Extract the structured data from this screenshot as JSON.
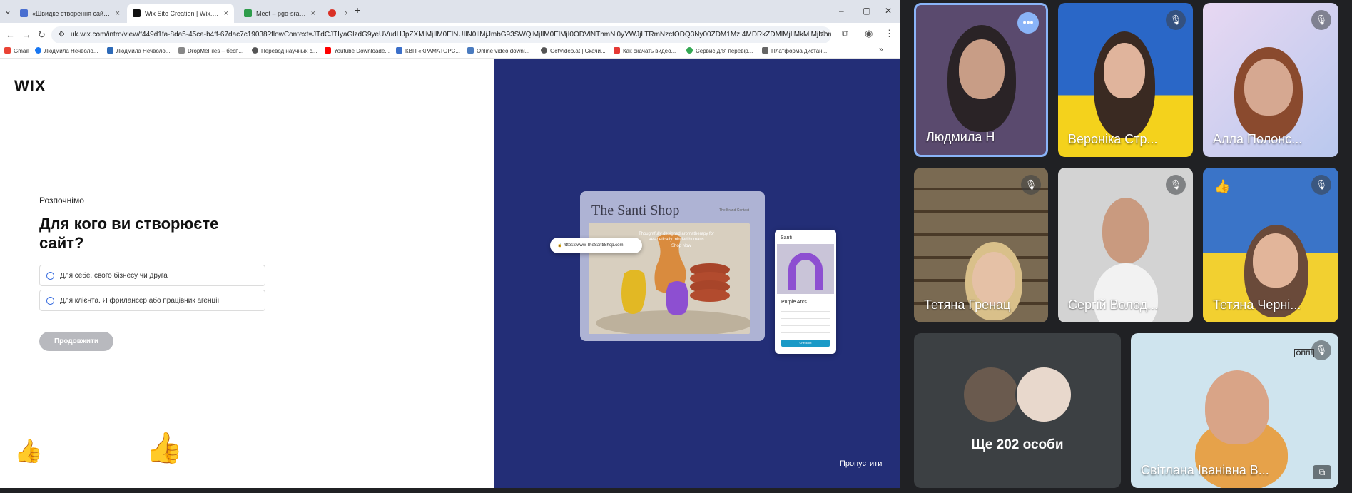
{
  "browser": {
    "tabs": [
      {
        "label": "«Швидке створення сайту в»",
        "close": "×",
        "favicon_color": "#4a6fd0"
      },
      {
        "label": "Wix Site Creation | Wix.com",
        "close": "×",
        "favicon_color": "#111111"
      },
      {
        "label": "Meet – pgo-srak-jkf",
        "close": "×",
        "favicon_color": "#2e9c4b"
      },
      {
        "label": "",
        "close": "×",
        "favicon_color": "#d93025"
      }
    ],
    "new_tab": "+",
    "window_controls": [
      "–",
      "▢",
      "✕"
    ],
    "url": "uk.wix.com/intro/view/f449d1fa-8da5-45ca-b4ff-67dac7c19038?flowContext=JTdCJTIyaGlzdG9yeUVudHJpZXMlMjIlM0ElNUIlN0IlMjJmbG93SWQlMjIlM0ElMjI0ODVlNThmNi0yYWJjLTRmNzctODQ3Ny00ZDM1MzI4MDRkZDMlMjIlMkMlMjIzbmFwc2hvdElkJTI...",
    "bookmarks": [
      {
        "label": "Gmail",
        "color": "#ea4335"
      },
      {
        "label": "Людмила Нечволо...",
        "color": "#1877f2"
      },
      {
        "label": "Людмила Нечволо...",
        "color": "#2d6ab8"
      },
      {
        "label": "DropMeFiles – бесп...",
        "color": "#888888"
      },
      {
        "label": "Перевод научных с...",
        "color": "#555555"
      },
      {
        "label": "Youtube Downloade...",
        "color": "#ff0000"
      },
      {
        "label": "КВП «КРАМАТОРС...",
        "color": "#3b6fc9"
      },
      {
        "label": "Online video downl...",
        "color": "#4a7bbf"
      },
      {
        "label": "GetVideo.at | Скачи...",
        "color": "#555555"
      },
      {
        "label": "Как скачать видео...",
        "color": "#e53935"
      },
      {
        "label": "Сервис для перевір...",
        "color": "#34a853"
      },
      {
        "label": "Платформа дистан...",
        "color": "#666666"
      }
    ]
  },
  "wix": {
    "logo": "WIX",
    "kicker": "Розпочнімо",
    "question": "Для кого ви створюєте сайт?",
    "options": [
      "Для себе, свого бізнесу чи друга",
      "Для клієнта. Я фрилансер або працівник агенції"
    ],
    "continue_label": "Продовжити",
    "skip_label": "Пропустити",
    "reactions": [
      "👍",
      "👍"
    ],
    "mockup": {
      "shop_title": "The Santi Shop",
      "nav_items": "The Brand   Contact",
      "tagline": "Thoughtfully designed aromatherapy for aesthetically minded humans",
      "shop_now": "Shop Now",
      "url_pill": "https://www.TheSantiShop.com",
      "mobile_brand": "Santi",
      "product_name": "Purple Arcs",
      "checkout": "Checkout"
    }
  },
  "meet": {
    "participants": [
      {
        "name": "Людмила Н",
        "muted": false,
        "bg": "#5a4a6e",
        "skin": "#c89d86"
      },
      {
        "name": "Вероніка Стр...",
        "muted": true,
        "bg": "#2a67c7",
        "skin": "#e0b49c"
      },
      {
        "name": "Алла Полонс...",
        "muted": true,
        "bg": "#d8c7e6",
        "skin": "#d6a891"
      },
      {
        "name": "Тетяна Гренац",
        "muted": true,
        "bg": "#7a6a52",
        "skin": "#e5c1a6"
      },
      {
        "name": "Сергій Волод...",
        "muted": true,
        "bg": "#cfcfcf",
        "skin": "#c99a7f"
      },
      {
        "name": "Тетяна Черні...",
        "muted": true,
        "bg": "#3a74c8",
        "skin": "#e2b59a"
      }
    ],
    "others_label": "Ще 202 особи",
    "speaker": {
      "name": "Світлана Іванівна В...",
      "muted": true,
      "watermark": "ОППІ"
    },
    "icons": {
      "muted": "mic-off-icon",
      "more": "more-options-icon",
      "pip": "picture-in-picture-icon"
    }
  }
}
